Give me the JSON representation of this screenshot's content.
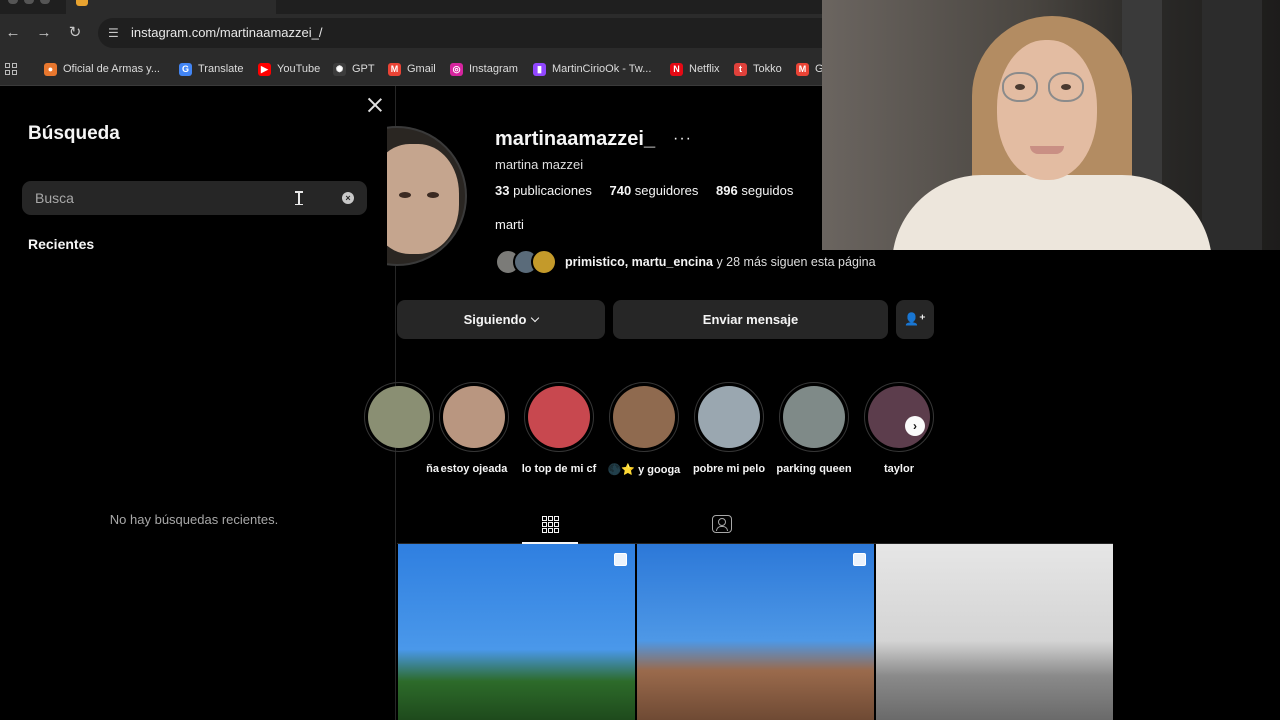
{
  "browser": {
    "url": "instagram.com/martinaamazzei_/",
    "bookmarks": [
      {
        "label": "Oficial de Armas y...",
        "icon": "globe-icon",
        "color": "#e8772e"
      },
      {
        "label": "Translate",
        "icon": "translate-icon",
        "color": "#4285f4"
      },
      {
        "label": "YouTube",
        "icon": "youtube-icon",
        "color": "#ff0000"
      },
      {
        "label": "GPT",
        "icon": "gpt-icon",
        "color": "#3c3c3c"
      },
      {
        "label": "Gmail",
        "icon": "gmail-icon",
        "color": "#ea4335"
      },
      {
        "label": "Instagram",
        "icon": "instagram-icon",
        "color": "#d6249f"
      },
      {
        "label": "MartinCirioOk - Tw...",
        "icon": "twitch-icon",
        "color": "#9146ff"
      },
      {
        "label": "Netflix",
        "icon": "netflix-icon",
        "color": "#e50914"
      },
      {
        "label": "Tokko",
        "icon": "tokko-icon",
        "color": "#e0413b"
      },
      {
        "label": "G",
        "icon": "gmail-icon",
        "color": "#ea4335"
      }
    ]
  },
  "search_panel": {
    "title": "Búsqueda",
    "placeholder": "Busca",
    "recent_heading": "Recientes",
    "empty_text": "No hay búsquedas recientes."
  },
  "profile": {
    "username": "martinaamazzei_",
    "full_name": "martina mazzei",
    "stats": {
      "posts_count": "33",
      "posts_label": " publicaciones",
      "followers_count": "740",
      "followers_label": " seguidores",
      "following_count": "896",
      "following_label": " seguidos"
    },
    "bio": "marti",
    "followed_by": {
      "names": "primistico, martu_encina",
      "rest": " y 28 más siguen esta página"
    },
    "buttons": {
      "following": "Siguiendo",
      "message": "Enviar mensaje"
    },
    "highlights": [
      {
        "label": "ña",
        "color": "#8a8f73"
      },
      {
        "label": "estoy ojeada",
        "color": "#b99680"
      },
      {
        "label": "lo top de mi cf",
        "color": "#c8484f"
      },
      {
        "label": "🌑⭐ y googa",
        "color": "#8f6a4f"
      },
      {
        "label": "pobre mi pelo",
        "color": "#9aa7b0"
      },
      {
        "label": "parking queen",
        "color": "#7f8a88"
      },
      {
        "label": "taylor",
        "color": "#5c3d4c"
      }
    ]
  },
  "colors": {
    "accent": "#0095f6",
    "surface": "#262626",
    "text_secondary": "#a8a8a8"
  }
}
